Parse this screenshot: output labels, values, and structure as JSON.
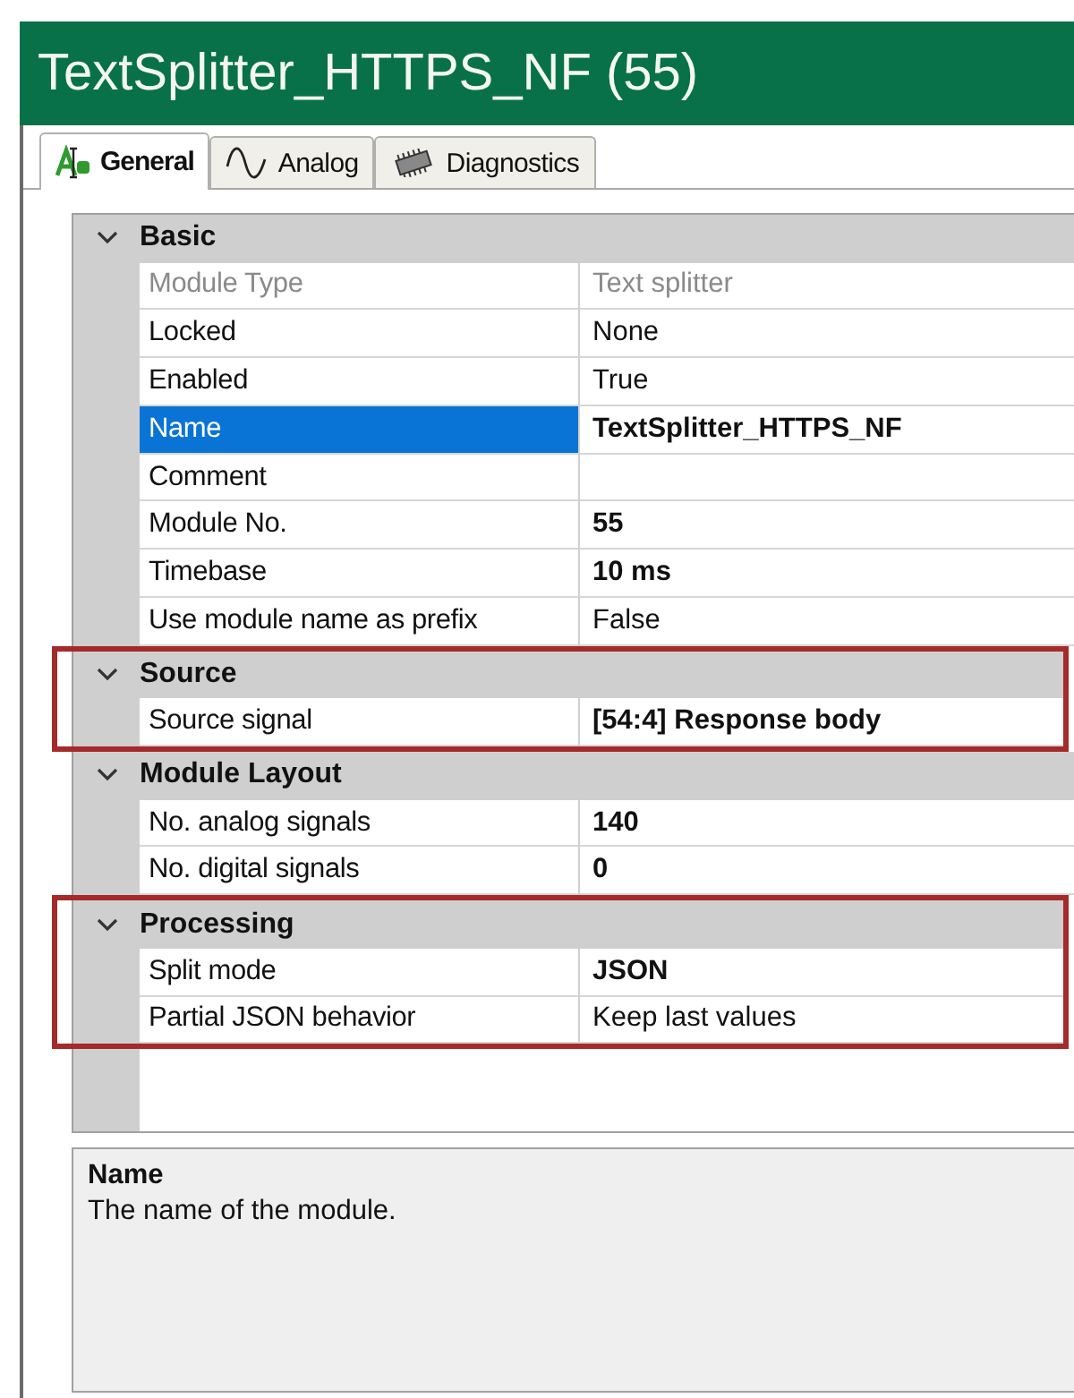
{
  "window": {
    "title": "TextSplitter_HTTPS_NF (55)"
  },
  "tabs": [
    {
      "label": "General",
      "selected": true
    },
    {
      "label": "Analog",
      "selected": false
    },
    {
      "label": "Diagnostics",
      "selected": false
    }
  ],
  "property_grid": {
    "categories": [
      {
        "name": "Basic",
        "expanded": true,
        "highlighted": false,
        "rows": [
          {
            "label": "Module Type",
            "value": "Text splitter",
            "disabled": true,
            "bold": false,
            "selected": false
          },
          {
            "label": "Locked",
            "value": "None",
            "disabled": false,
            "bold": false,
            "selected": false
          },
          {
            "label": "Enabled",
            "value": "True",
            "disabled": false,
            "bold": false,
            "selected": false
          },
          {
            "label": "Name",
            "value": "TextSplitter_HTTPS_NF",
            "disabled": false,
            "bold": true,
            "selected": true
          },
          {
            "label": "Comment",
            "disabled": false,
            "bold": false,
            "selected": false
          },
          {
            "label": "Module No.",
            "value": "55",
            "disabled": false,
            "bold": true,
            "selected": false
          },
          {
            "label": "Timebase",
            "value": "10 ms",
            "disabled": false,
            "bold": true,
            "selected": false
          },
          {
            "label": "Use module name as prefix",
            "value": "False",
            "disabled": false,
            "bold": false,
            "selected": false
          }
        ]
      },
      {
        "name": "Source",
        "expanded": true,
        "highlighted": true,
        "rows": [
          {
            "label": "Source signal",
            "value": "[54:4] Response body",
            "disabled": false,
            "bold": true,
            "selected": false
          }
        ]
      },
      {
        "name": "Module Layout",
        "expanded": true,
        "highlighted": false,
        "rows": [
          {
            "label": "No. analog signals",
            "value": "140",
            "disabled": false,
            "bold": true,
            "selected": false
          },
          {
            "label": "No. digital signals",
            "value": "0",
            "disabled": false,
            "bold": true,
            "selected": false
          }
        ]
      },
      {
        "name": "Processing",
        "expanded": true,
        "highlighted": true,
        "rows": [
          {
            "label": "Split mode",
            "value": "JSON",
            "disabled": false,
            "bold": true,
            "selected": false
          },
          {
            "label": "Partial JSON behavior",
            "value": "Keep last values",
            "disabled": false,
            "bold": false,
            "selected": false
          }
        ]
      }
    ]
  },
  "description": {
    "title": "Name",
    "text": "The name of the module."
  }
}
